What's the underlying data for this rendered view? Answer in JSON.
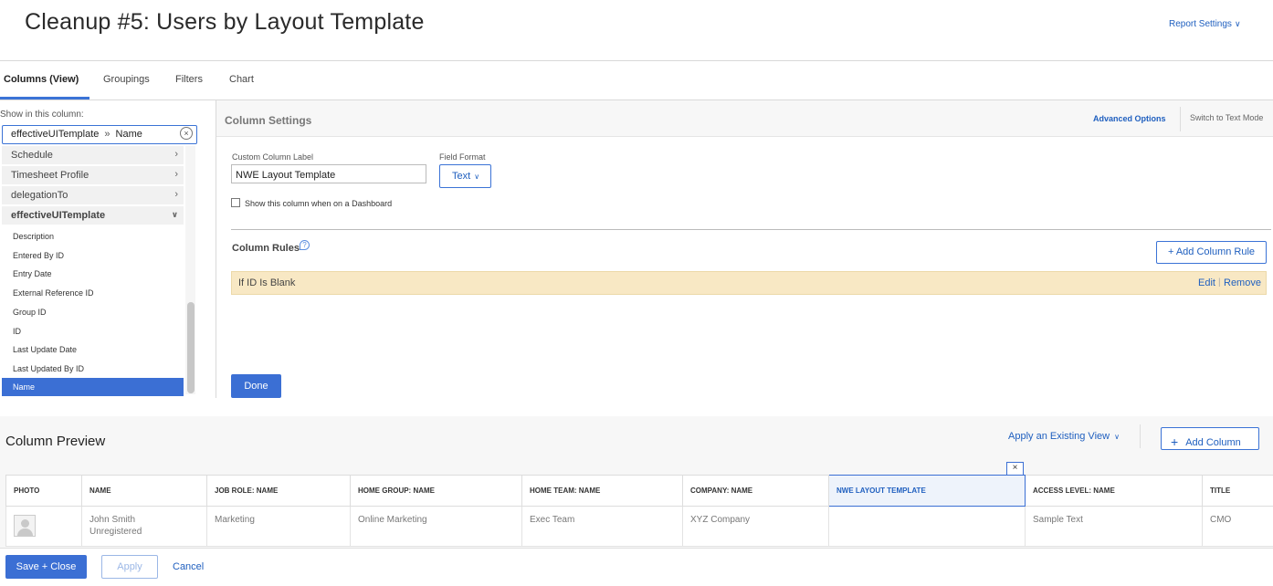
{
  "header": {
    "title": "Cleanup #5: Users by Layout Template",
    "report_settings": "Report Settings"
  },
  "tabs": [
    {
      "label": "Columns (View)",
      "active": true
    },
    {
      "label": "Groupings"
    },
    {
      "label": "Filters"
    },
    {
      "label": "Chart"
    }
  ],
  "field_picker": {
    "show_label": "Show in this column:",
    "path_parent": "effectiveUITemplate",
    "path_child": "Name",
    "groups": [
      {
        "label": "Schedule",
        "icon": "chevron-right-icon"
      },
      {
        "label": "Timesheet Profile",
        "icon": "chevron-right-icon"
      },
      {
        "label": "delegationTo",
        "icon": "chevron-right-icon"
      },
      {
        "label": "effectiveUITemplate",
        "icon": "chevron-down-icon",
        "expanded": true
      }
    ],
    "fields": [
      "Description",
      "Entered By ID",
      "Entry Date",
      "External Reference ID",
      "Group ID",
      "ID",
      "Last Update Date",
      "Last Updated By ID",
      "Name"
    ],
    "selected_field": "Name"
  },
  "column_settings": {
    "title": "Column Settings",
    "advanced_options": "Advanced Options",
    "switch_text_mode": "Switch to Text Mode",
    "custom_label_label": "Custom Column Label",
    "custom_label_value": "NWE Layout Template",
    "field_format_label": "Field Format",
    "field_format_value": "Text",
    "dashboard_checkbox_label": "Show this column when on a Dashboard",
    "dashboard_checked": false,
    "rules_title": "Column Rules",
    "add_rule": "+ Add Column Rule",
    "rule_text": "If ID Is Blank",
    "rule_edit": "Edit",
    "rule_sep": "|",
    "rule_remove": "Remove",
    "done": "Done"
  },
  "preview": {
    "title": "Column Preview",
    "apply_view": "Apply an Existing View",
    "add_column": "Add Column",
    "remove_column_glyph": "×",
    "columns": [
      "PHOTO",
      "NAME",
      "JOB ROLE: NAME",
      "HOME GROUP: NAME",
      "HOME TEAM: NAME",
      "COMPANY: NAME",
      "NWE LAYOUT TEMPLATE",
      "ACCESS LEVEL: NAME",
      "TITLE"
    ],
    "selected_column": "NWE LAYOUT TEMPLATE",
    "row": {
      "name_line1": "John Smith",
      "name_line2": "Unregistered",
      "job_role": "Marketing",
      "home_group": "Online Marketing",
      "home_team": "Exec Team",
      "company": "XYZ Company",
      "layout_template": "",
      "access_level": "Sample Text",
      "title": "CMO"
    }
  },
  "footer": {
    "save_close": "Save + Close",
    "apply": "Apply",
    "cancel": "Cancel"
  },
  "colors": {
    "accent": "#3b6fd4",
    "link": "#1f5fbf",
    "rule_bg": "#f8e8c4"
  }
}
